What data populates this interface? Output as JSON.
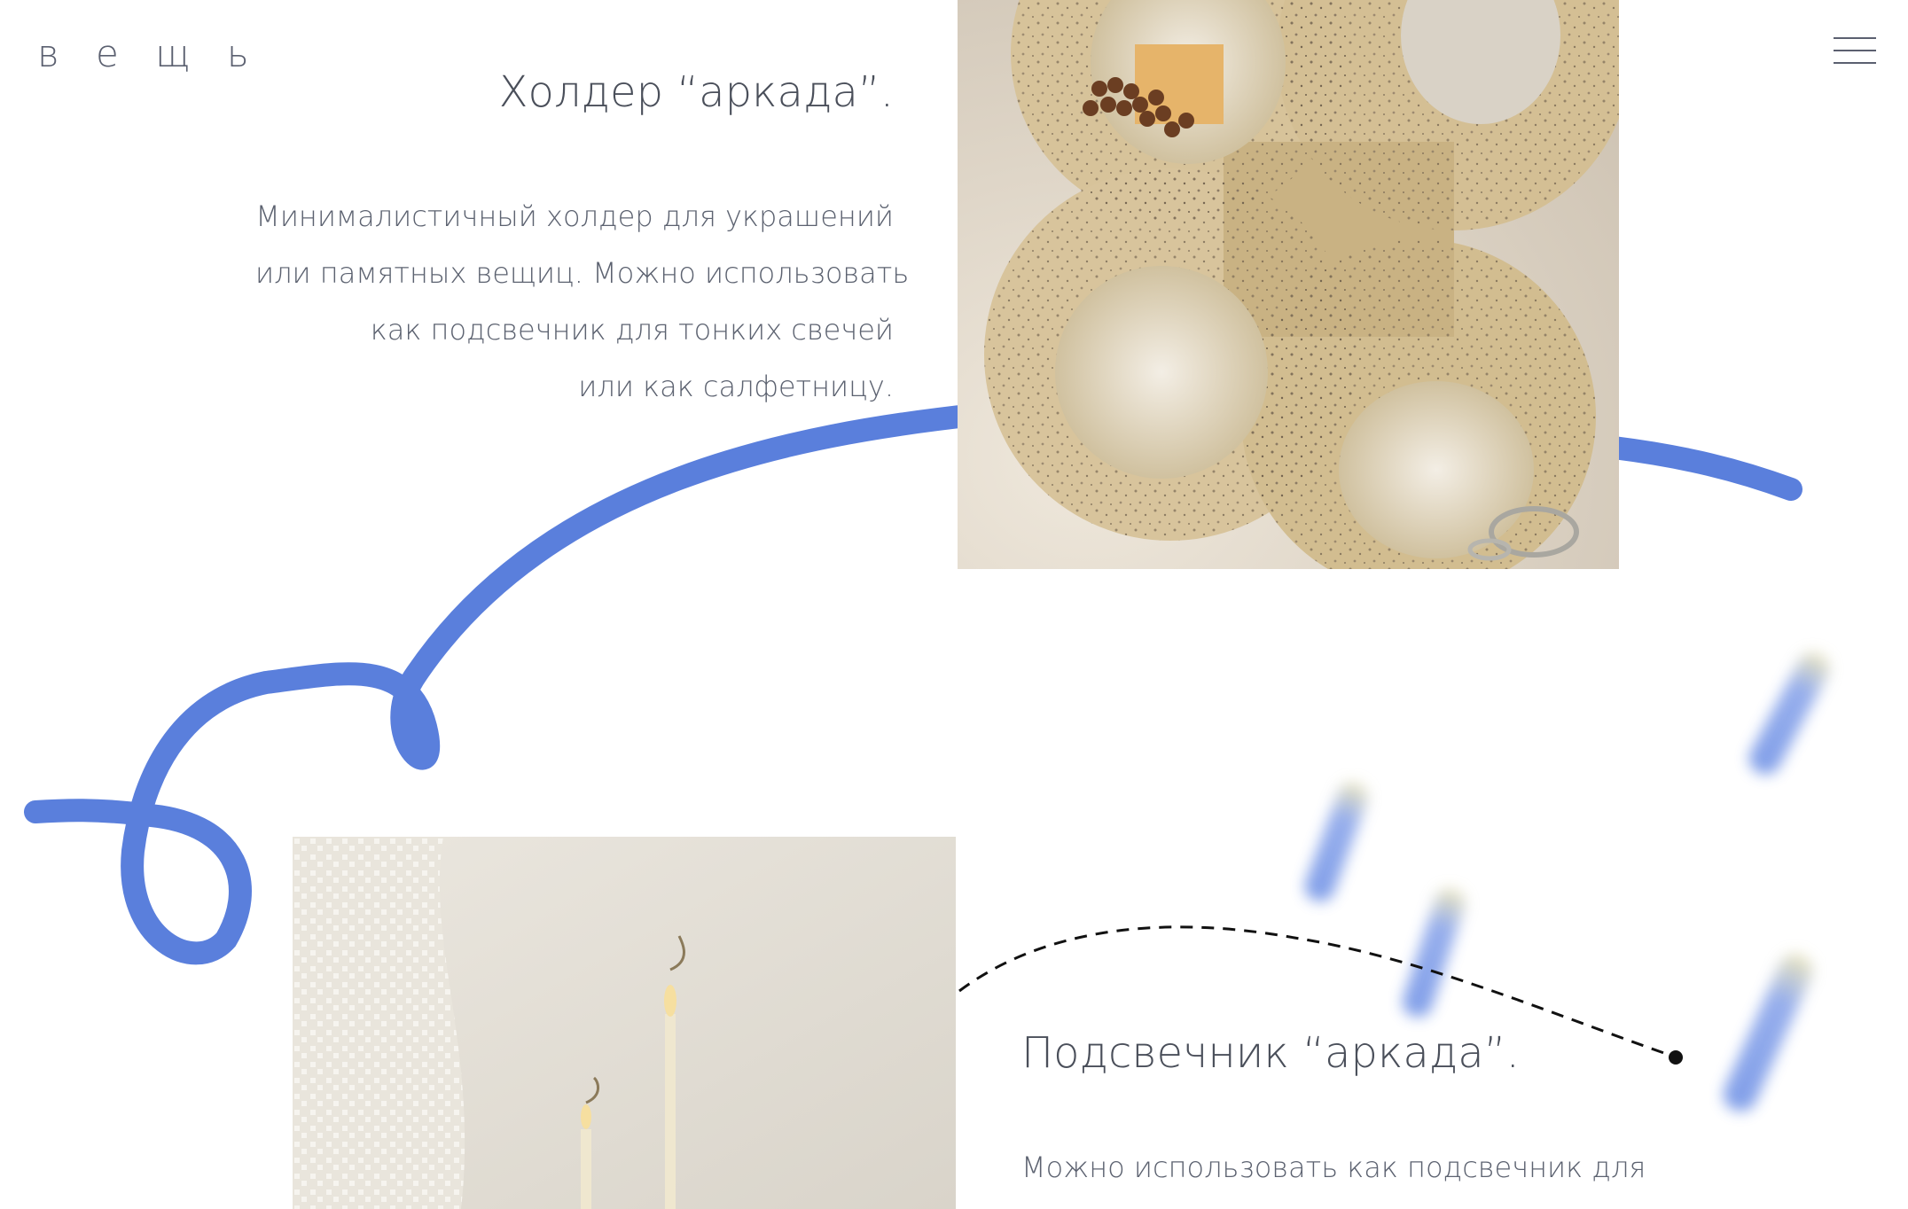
{
  "header": {
    "logo": "в е щ ь",
    "menu_icon": "hamburger-menu-icon"
  },
  "section1": {
    "title": "Холдер “аркада”.",
    "description_lines": [
      "Минималистичный  холдер для украшений",
      "или памятных вещиц. Можно использовать",
      "как подсвечник для тонких свечей",
      "или как салфетницу."
    ],
    "image_alt": "ceramic-arch-holder-photo"
  },
  "section2": {
    "title": "Подсвечник “аркада”.",
    "description_line": "Можно использовать как подсвечник для",
    "image_alt": "candles-photo"
  },
  "colors": {
    "accent_blue": "#5a7fdc",
    "text": "#4a4f5a",
    "clay": "#d8c6a0"
  }
}
